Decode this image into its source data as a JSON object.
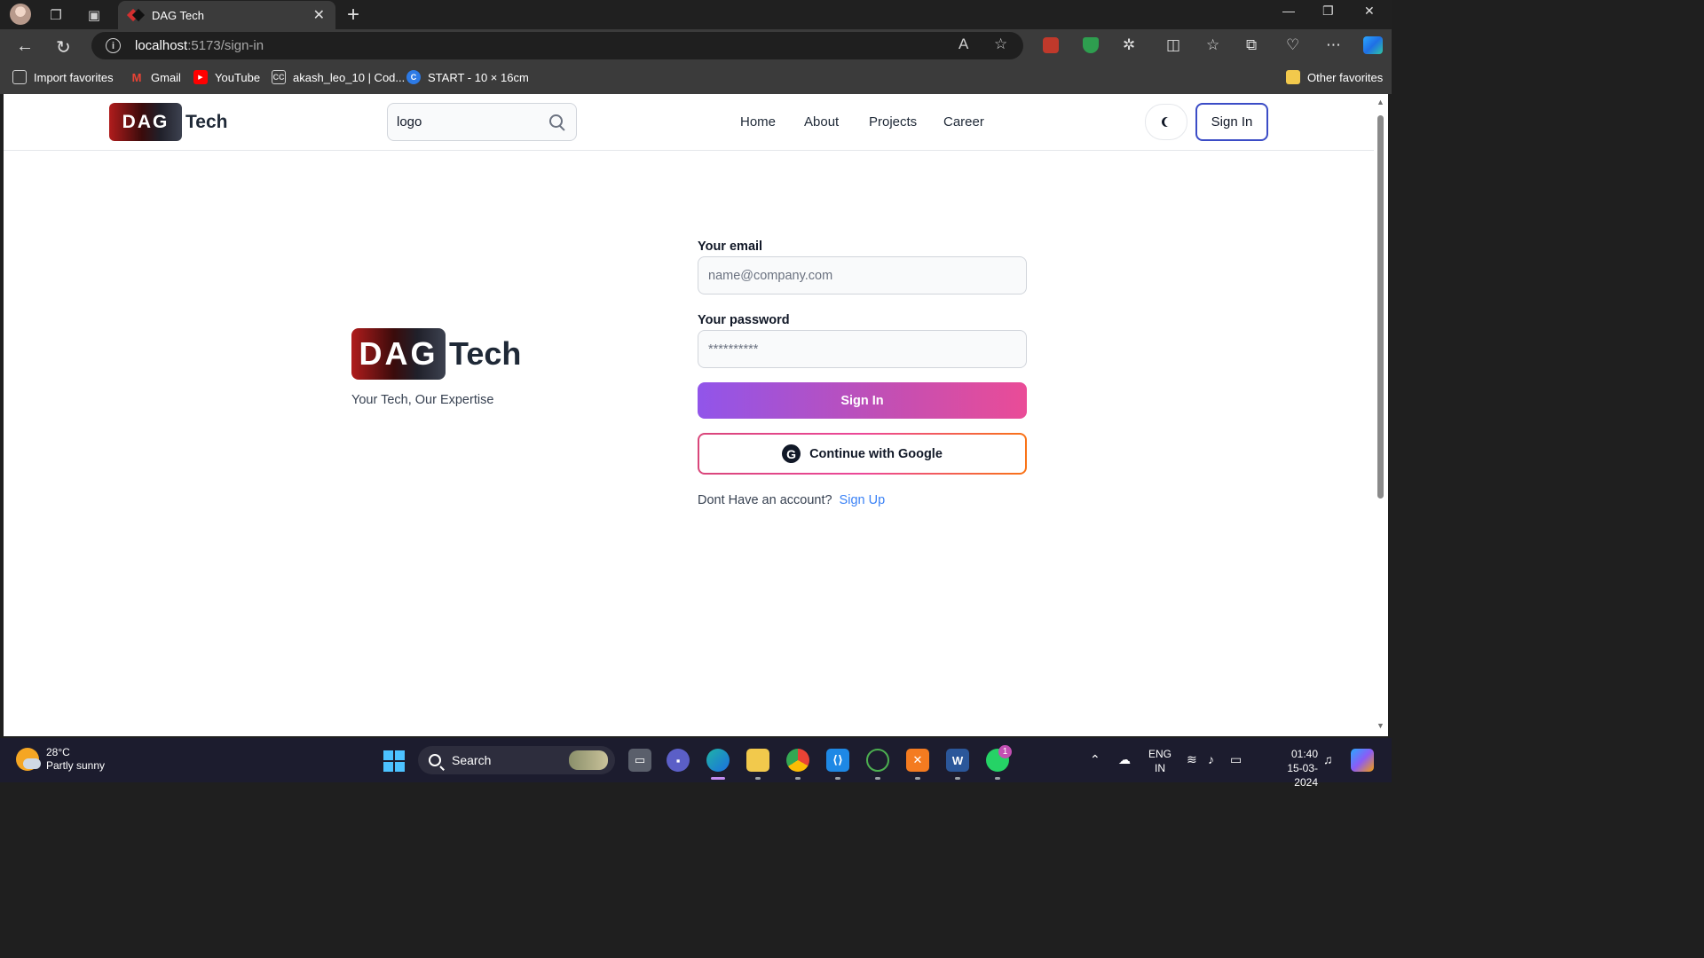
{
  "browser": {
    "tab_title": "DAG Tech",
    "url_host": "localhost",
    "url_path": ":5173/sign-in",
    "favorites": [
      {
        "label": "Import favorites",
        "icon": "import-icon"
      },
      {
        "label": "Gmail",
        "icon": "gmail-icon"
      },
      {
        "label": "YouTube",
        "icon": "youtube-icon"
      },
      {
        "label": "akash_leo_10 | Cod...",
        "icon": "codechef-icon"
      },
      {
        "label": "START - 10 × 16cm",
        "icon": "canva-icon"
      }
    ],
    "other_favorites": "Other favorites"
  },
  "site": {
    "logo_badge": "DAG",
    "logo_text": "Tech",
    "search_value": "logo",
    "nav": [
      "Home",
      "About",
      "Projects",
      "Career"
    ],
    "signin_top": "Sign In"
  },
  "hero": {
    "logo_badge": "DAG",
    "logo_text": "Tech",
    "tagline": "Your Tech, Our Expertise"
  },
  "form": {
    "email_label": "Your email",
    "email_placeholder": "name@company.com",
    "password_label": "Your password",
    "password_placeholder": "**********",
    "signin_button": "Sign In",
    "google_icon": "G",
    "google_button": "Continue with Google",
    "no_account_text": "Dont Have an account?",
    "signup_link": "Sign Up"
  },
  "taskbar": {
    "temp": "28°C",
    "condition": "Partly sunny",
    "search": "Search",
    "notification_count": "1",
    "lang_top": "ENG",
    "lang_bottom": "IN",
    "time": "01:40",
    "date": "15-03-2024"
  },
  "colors": {
    "primary_gradient_start": "#9155ea",
    "primary_gradient_end": "#ea4c97",
    "link": "#3b82f6",
    "signin_border": "#3b4cc6"
  }
}
